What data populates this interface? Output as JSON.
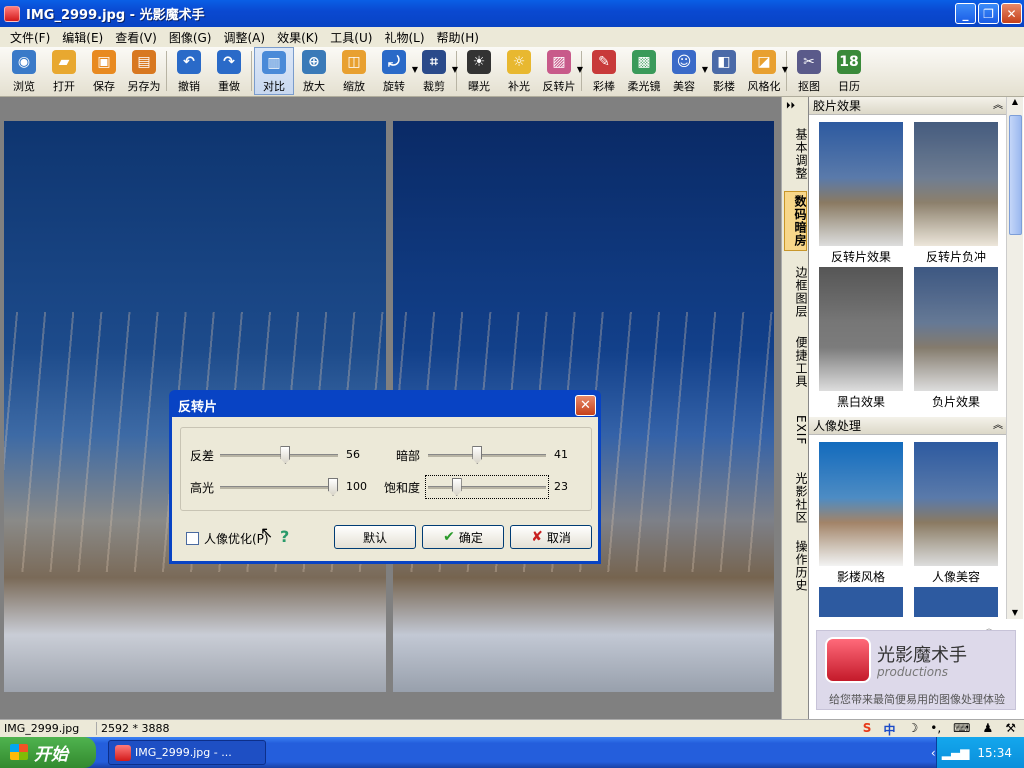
{
  "window": {
    "title": "IMG_2999.jpg - 光影魔术手"
  },
  "menu": [
    "文件(F)",
    "编辑(E)",
    "查看(V)",
    "图像(G)",
    "调整(A)",
    "效果(K)",
    "工具(U)",
    "礼物(L)",
    "帮助(H)"
  ],
  "toolbar": [
    {
      "label": "浏览",
      "color": "#3a7ac8",
      "glyph": "◉"
    },
    {
      "label": "打开",
      "color": "#e8a830",
      "glyph": "▰"
    },
    {
      "label": "保存",
      "color": "#e88a20",
      "glyph": "▣"
    },
    {
      "label": "另存为",
      "color": "#d87820",
      "glyph": "▤"
    },
    {
      "label": "撤销",
      "color": "#2a6ac8",
      "glyph": "↶"
    },
    {
      "label": "重做",
      "color": "#2a6ac8",
      "glyph": "↷"
    },
    {
      "label": "对比",
      "color": "#4a8ad8",
      "glyph": "▥"
    },
    {
      "label": "放大",
      "color": "#3a7ab8",
      "glyph": "⊕"
    },
    {
      "label": "缩放",
      "color": "#e8a030",
      "glyph": "◫"
    },
    {
      "label": "旋转",
      "color": "#2a6ac8",
      "glyph": "⤾"
    },
    {
      "label": "裁剪",
      "color": "#2a4a8a",
      "glyph": "⌗"
    },
    {
      "label": "曝光",
      "color": "#333",
      "glyph": "☀"
    },
    {
      "label": "补光",
      "color": "#e8b830",
      "glyph": "☼"
    },
    {
      "label": "反转片",
      "color": "#c85a8a",
      "glyph": "▨"
    },
    {
      "label": "彩棒",
      "color": "#c83a3a",
      "glyph": "✎"
    },
    {
      "label": "柔光镜",
      "color": "#3a9a5a",
      "glyph": "▩"
    },
    {
      "label": "美容",
      "color": "#3a6ac8",
      "glyph": "☺"
    },
    {
      "label": "影楼",
      "color": "#4a6aa8",
      "glyph": "◧"
    },
    {
      "label": "风格化",
      "color": "#e8a030",
      "glyph": "◪"
    },
    {
      "label": "抠图",
      "color": "#5a5a8a",
      "glyph": "✂"
    },
    {
      "label": "日历",
      "color": "#3a8a3a",
      "glyph": "18"
    }
  ],
  "vtabs": [
    "基本调整",
    "数码暗房",
    "边框图层",
    "便捷工具",
    "EXIF",
    "光影社区",
    "操作历史"
  ],
  "panel": {
    "sec1": "胶片效果",
    "sec2": "人像处理",
    "thumbs1": [
      "反转片效果",
      "反转片负冲",
      "黑白效果",
      "负片效果"
    ],
    "thumbs2": [
      "影楼风格",
      "人像美容"
    ]
  },
  "logo": {
    "name": "光影魔术手",
    "sub": "productions",
    "tagline": "给您带来最简便易用的图像处理体验"
  },
  "status": {
    "filename": "IMG_2999.jpg",
    "size": "2592 * 3888"
  },
  "taskbar": {
    "start": "开始",
    "task": "IMG_2999.jpg - ...",
    "time": "15:34",
    "ime": "中"
  },
  "dialog": {
    "title": "反转片",
    "sliders": [
      {
        "label": "反差",
        "value": 56,
        "max": 100
      },
      {
        "label": "暗部",
        "value": 41,
        "max": 100
      },
      {
        "label": "高光",
        "value": 100,
        "max": 100
      },
      {
        "label": "饱和度",
        "value": 23,
        "max": 100
      }
    ],
    "checkbox": "人像优化(P)",
    "buttons": {
      "default": "默认",
      "ok": "确定",
      "cancel": "取消"
    }
  }
}
